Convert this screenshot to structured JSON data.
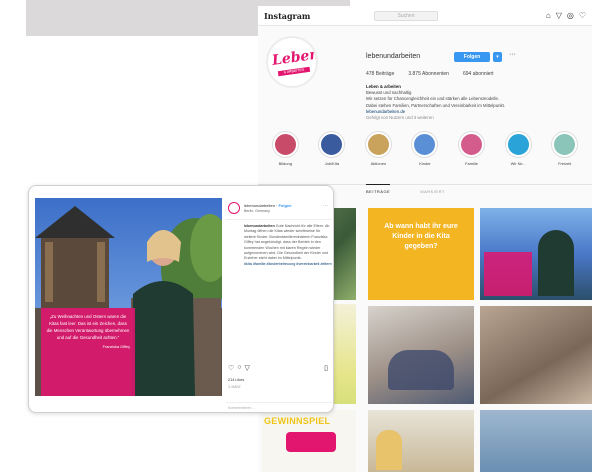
{
  "profile": {
    "platform_logo": "Instagram",
    "search_placeholder": "Suchen",
    "nav_icons": [
      "home-icon",
      "direct-icon",
      "explore-icon",
      "heart-icon"
    ],
    "username": "lebenundarbeiten",
    "follow_label": "Folgen",
    "logo_word": "Leben",
    "logo_sub": "& ARBEITEN",
    "stats": {
      "posts": "478 Beiträge",
      "followers": "3.875 Abonnenten",
      "following": "694 abonniert"
    },
    "bio": {
      "name": "Leben & arbeiten",
      "lines": [
        "Bewusst und nachhaltig",
        "Wir setzen für Chancengleichheit ein und stärken alle Lebensmodelle.",
        "Dabei stehen Familien, Partnerschaften und Vereinbarkeit im Mittelpunkt."
      ],
      "link": "lebenundarbeiten.de",
      "followed_by": "Gefolgt von Nutzern und 3 weiteren"
    },
    "highlights": [
      {
        "label": "Bildung",
        "color": "#c94b6a"
      },
      {
        "label": "Job/Kita",
        "color": "#3a5c9e"
      },
      {
        "label": "Aktionen",
        "color": "#c9a25b"
      },
      {
        "label": "Kinder",
        "color": "#5a8fd6"
      },
      {
        "label": "Familie",
        "color": "#d45c8c"
      },
      {
        "label": "Wir für...",
        "color": "#2aa3d8"
      },
      {
        "label": "Freizeit",
        "color": "#8bc4b8"
      }
    ],
    "tabs": [
      "BEITRÄGE",
      "MARKIERT"
    ],
    "grid": {
      "kita_question": "Ab wann habt ihr eure Kinder in die Kita gegeben?",
      "gewinnspiel": "GEWINNSPIEL"
    }
  },
  "card": {
    "username": "lebenundarbeiten",
    "follow": "Folgen",
    "location": "Berlin, Germany",
    "quote": "„Zu Weihnachten und Ostern waren die Kitas fast leer. Das ist ein Zeichen, dass die Menschen Verantwortung übernehmen und auf die Gesundheit achten.“",
    "quote_attr": "Franziska Giffey",
    "caption_user": "lebenundarbeiten",
    "caption": "Gute Nachricht für alle Eltern: Ab Montag öffnen die Kitas wieder schrittweise für weitere Kinder. Bundesfamilienministerin Franziska Giffey hat angekündigt, dass der Betrieb in den kommenden Wochen mit klaren Regeln wieder aufgenommen wird. Die Gesundheit der Kinder und Erzieher steht dabei im Mittelpunkt.",
    "hashtags": "#kita #familie #kinderbetreuung #vereinbarkeit #eltern",
    "likes": "214 Likes",
    "date": "3. MÄRZ",
    "comment_placeholder": "Kommentieren ..."
  },
  "colors": {
    "accent": "#e2156f",
    "link": "#3897f0"
  }
}
